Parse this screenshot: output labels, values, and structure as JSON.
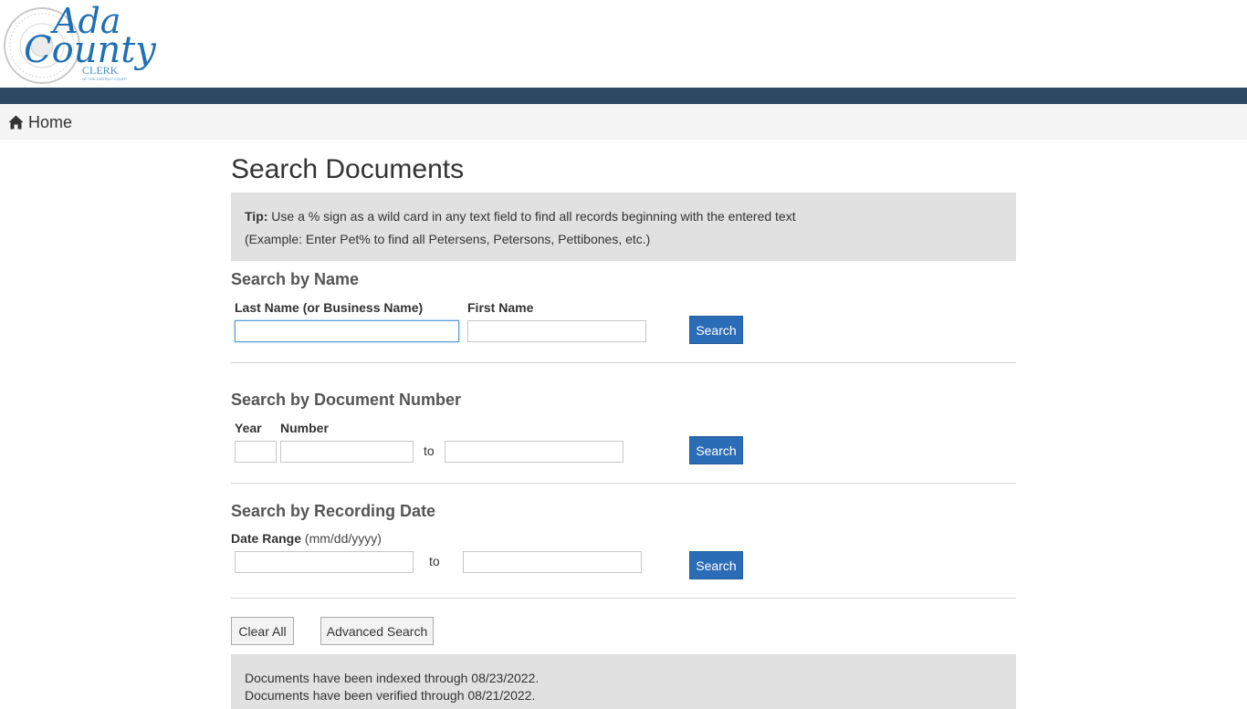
{
  "header": {
    "logo_text": [
      "Ada",
      "County",
      "CLERK",
      "OF THE DISTRICT COURT"
    ],
    "seal_text": "DISTRICT COURT 4TH JUDICIAL ADA COUNTY",
    "stripe_color": "#2c4a63"
  },
  "breadcrumb": {
    "home_label": "Home",
    "home_icon": "home-icon"
  },
  "page": {
    "title": "Search Documents"
  },
  "tip": {
    "label": "Tip:",
    "text": "Use a % sign as a wild card in any text field to find all records beginning with the entered text",
    "example": "(Example: Enter Pet% to find all Petersens, Petersons, Pettibones, etc.)"
  },
  "search_by_name": {
    "heading": "Search by Name",
    "last_name_label": "Last Name (or Business Name)",
    "first_name_label": "First Name",
    "last_name_value": "",
    "first_name_value": "",
    "search_label": "Search"
  },
  "search_by_document": {
    "heading": "Search by Document Number",
    "year_label": "Year",
    "number_label": "Number",
    "to_label": "to",
    "year_value": "",
    "number_from_value": "",
    "number_to_value": "",
    "search_label": "Search"
  },
  "search_by_date": {
    "heading": "Search by Recording Date",
    "range_label": "Date Range",
    "range_hint": "(mm/dd/yyyy)",
    "to_label": "to",
    "from_value": "",
    "to_value": "",
    "search_label": "Search"
  },
  "actions": {
    "clear_all_label": "Clear All",
    "advanced_search_label": "Advanced Search"
  },
  "status": {
    "indexed": "Documents have been indexed through 08/23/2022.",
    "verified": "Documents have been verified through 08/21/2022."
  },
  "colors": {
    "primary_button": "#2b6cb7",
    "tip_background": "#e1e1e1",
    "logo_blue": "#2f7fc1"
  }
}
